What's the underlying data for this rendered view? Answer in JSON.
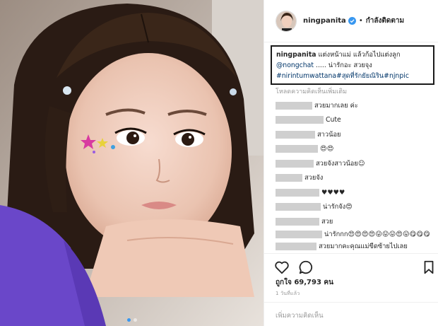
{
  "post": {
    "username": "ningpanita",
    "verified_icon": "verified-badge-icon",
    "separator": "•",
    "follow_label": "กำลังติดตาม",
    "caption": {
      "username": "ningpanita",
      "line1": "แต่งหน้าแม่ แล้วก้อไปแต่งลูก",
      "mention": "@nongchat",
      "line2_text": "..... น่ารักอะ สวยจุง",
      "hashtag1": "#nirintumwattana",
      "hashtag2": "#สุดที่รักยัยณิริน",
      "hashtag3": "#njnpic"
    },
    "load_more_label": "โหลดความคิดเห็นเพิ่มเติม",
    "comments": [
      {
        "text": "สวยมากเลย ค่ะ"
      },
      {
        "text": "Cute"
      },
      {
        "text": "สาวน้อย"
      },
      {
        "text": "😍😍"
      },
      {
        "text": "สวยจังสาวน้อย☺"
      },
      {
        "text": "สวยจัง"
      },
      {
        "text": "♥♥♥♥"
      },
      {
        "text": "น่ารักจัง😍"
      },
      {
        "text": "สวย"
      },
      {
        "text": "น่ารักกก😍😍😍😍😛😛😛😍😛😋😋😋"
      },
      {
        "text": "สวยมากคะคุณแม่ขีดซ้ายไปเลย"
      }
    ],
    "likes_text": "ถูกใจ 69,793 คน",
    "timestamp": "1 วันที่แล้ว",
    "add_comment_placeholder": "เพิ่มความคิดเห็น"
  },
  "icons": [
    "heart-icon",
    "comment-icon",
    "bookmark-icon"
  ],
  "colors": {
    "hashtag": "#003569",
    "secondary_text": "#999999",
    "border": "#efefef",
    "verified": "#3897f0"
  }
}
